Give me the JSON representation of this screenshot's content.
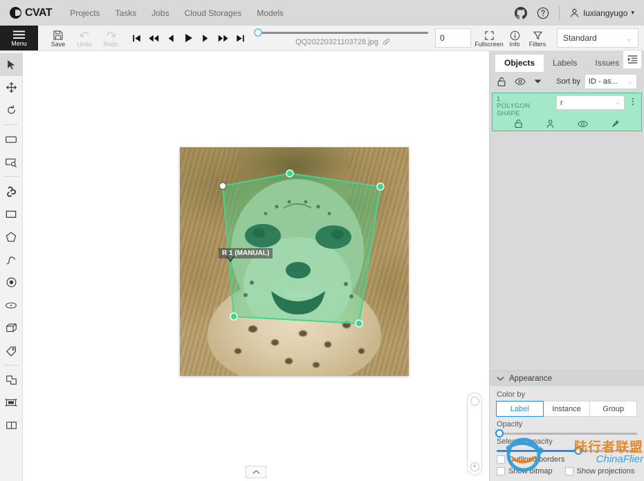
{
  "app": {
    "name": "CVAT",
    "logo_icon": "cvat-logo-icon"
  },
  "header": {
    "nav": [
      {
        "label": "Projects",
        "name": "nav-projects"
      },
      {
        "label": "Tasks",
        "name": "nav-tasks"
      },
      {
        "label": "Jobs",
        "name": "nav-jobs"
      },
      {
        "label": "Cloud Storages",
        "name": "nav-cloud-storages"
      },
      {
        "label": "Models",
        "name": "nav-models"
      }
    ],
    "github_icon": "github-icon",
    "help_icon": "question-circle-icon",
    "user_icon": "user-icon",
    "username": "luxiangyugo",
    "caret": "▾"
  },
  "toolbar": {
    "menu_label": "Menu",
    "menu_icon": "hamburger-icon",
    "save_label": "Save",
    "save_icon": "floppy-disk-icon",
    "undo_label": "Undo",
    "undo_icon": "undo-arrow-icon",
    "redo_label": "Redo",
    "redo_icon": "redo-arrow-icon",
    "nav_buttons": [
      {
        "name": "first-frame-button",
        "icon": "skip-to-start-icon"
      },
      {
        "name": "back-many-frames-button",
        "icon": "double-chevron-left-icon"
      },
      {
        "name": "previous-frame-button",
        "icon": "chevron-left-icon"
      },
      {
        "name": "play-button",
        "icon": "play-icon"
      },
      {
        "name": "next-frame-button",
        "icon": "chevron-right-icon"
      },
      {
        "name": "forward-many-frames-button",
        "icon": "double-chevron-right-icon"
      },
      {
        "name": "last-frame-button",
        "icon": "skip-to-end-icon"
      }
    ],
    "frame_filename": "QQ20220321103728.jpg",
    "link_icon": "link-icon",
    "frame_number": "0",
    "fullscreen_label": "Fullscreen",
    "fullscreen_icon": "fullscreen-icon",
    "info_label": "Info",
    "info_icon": "info-circle-icon",
    "filters_label": "Filters",
    "filters_icon": "funnel-icon",
    "workspace_value": "Standard",
    "workspace_caret": "⌄"
  },
  "tools": [
    {
      "name": "cursor-tool",
      "icon": "cursor-arrow-icon",
      "active": true
    },
    {
      "name": "move-tool",
      "icon": "move-cross-icon",
      "active": false
    },
    {
      "name": "rotate-tool",
      "icon": "rotate-icon",
      "active": false
    },
    {
      "name": "fit-image-tool",
      "icon": "fit-rectangle-icon",
      "active": false
    },
    {
      "name": "select-region-tool",
      "icon": "region-magnifier-icon",
      "active": false
    },
    {
      "name": "ai-tools",
      "icon": "ai-magic-icon",
      "active": false
    },
    {
      "name": "draw-rectangle-tool",
      "icon": "rectangle-icon",
      "active": false
    },
    {
      "name": "draw-polygon-tool",
      "icon": "polygon-icon",
      "active": false
    },
    {
      "name": "draw-polyline-tool",
      "icon": "polyline-icon",
      "active": false
    },
    {
      "name": "draw-points-tool",
      "icon": "points-icon",
      "active": false
    },
    {
      "name": "draw-ellipse-tool",
      "icon": "ellipse-icon",
      "active": false
    },
    {
      "name": "draw-cuboid-tool",
      "icon": "cuboid-icon",
      "active": false
    },
    {
      "name": "setup-tag-tool",
      "icon": "tag-icon",
      "active": false
    },
    {
      "name": "merge-tool",
      "icon": "merge-shapes-icon",
      "active": false
    },
    {
      "name": "split-tool",
      "icon": "split-track-icon",
      "active": false
    },
    {
      "name": "group-tool",
      "icon": "group-shapes-icon",
      "active": false
    }
  ],
  "canvas": {
    "annotation_label": "R 1 (MANUAL)",
    "shape_color": "#3fd68f",
    "shape_fill": "rgba(63,214,143,0.42)",
    "zoom_slider_icon": "zoom-slider-handle",
    "zoom_in_icon": "plus-circle-icon",
    "collapse_icon": "chevron-up-icon"
  },
  "right_panel": {
    "toggle_icon": "list-toggle-icon",
    "tabs": [
      {
        "label": "Objects",
        "name": "tab-objects",
        "active": true
      },
      {
        "label": "Labels",
        "name": "tab-labels",
        "active": false
      },
      {
        "label": "Issues",
        "name": "tab-issues",
        "active": false
      }
    ],
    "header_icons": [
      {
        "name": "lock-all-icon",
        "icon": "unlock-icon"
      },
      {
        "name": "hide-all-icon",
        "icon": "eye-icon"
      },
      {
        "name": "collapse-all-icon",
        "icon": "caret-down-icon"
      }
    ],
    "sort_by_label": "Sort by",
    "sort_by_value": "ID - as...",
    "sort_caret": "⌄",
    "objects": [
      {
        "id": "1",
        "type": "POLYGON SHAPE",
        "label": "r",
        "label_caret": "⌄",
        "actions": [
          {
            "name": "object-lock-icon",
            "icon": "unlock-icon"
          },
          {
            "name": "object-occluded-icon",
            "icon": "person-icon"
          },
          {
            "name": "object-hide-icon",
            "icon": "eye-icon"
          },
          {
            "name": "object-pin-icon",
            "icon": "pin-icon"
          }
        ]
      }
    ]
  },
  "appearance": {
    "title": "Appearance",
    "collapse_icon": "chevron-down-icon",
    "color_by_label": "Color by",
    "color_by_options": [
      {
        "label": "Label",
        "active": true
      },
      {
        "label": "Instance",
        "active": false
      },
      {
        "label": "Group",
        "active": false
      }
    ],
    "opacity_label": "Opacity",
    "opacity_value": 2,
    "selected_opacity_label": "Selected opacity",
    "selected_opacity_value": 58,
    "checkboxes": [
      {
        "label": "Outlined borders",
        "checked": false,
        "name": "outlined-borders-checkbox"
      },
      {
        "label": "Show bitmap",
        "checked": false,
        "name": "show-bitmap-checkbox"
      },
      {
        "label": "Show projections",
        "checked": false,
        "name": "show-projections-checkbox"
      }
    ]
  },
  "watermark": {
    "text_cn": "陆行者联盟",
    "text_en": "ChinaFlier"
  }
}
